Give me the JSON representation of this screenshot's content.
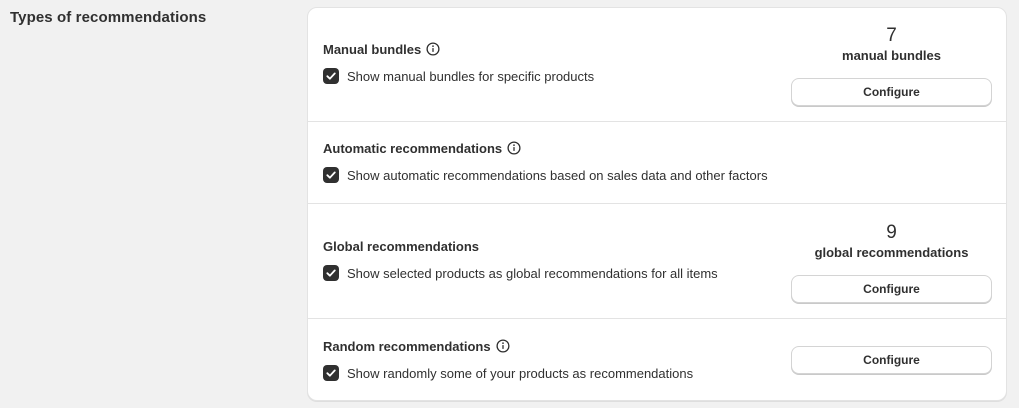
{
  "section": {
    "title": "Types of recommendations"
  },
  "rows": [
    {
      "title": "Manual bundles",
      "has_info": true,
      "checkbox_checked": true,
      "checkbox_label": "Show manual bundles for specific products",
      "stat_number": "7",
      "stat_label": "manual bundles",
      "button_label": "Configure"
    },
    {
      "title": "Automatic recommendations",
      "has_info": true,
      "checkbox_checked": true,
      "checkbox_label": "Show automatic recommendations based on sales data and other factors"
    },
    {
      "title": "Global recommendations",
      "has_info": false,
      "checkbox_checked": true,
      "checkbox_label": "Show selected products as global recommendations for all items",
      "stat_number": "9",
      "stat_label": "global recommendations",
      "button_label": "Configure"
    },
    {
      "title": "Random recommendations",
      "has_info": true,
      "checkbox_checked": true,
      "checkbox_label": "Show randomly some of your products as recommendations",
      "button_label": "Configure"
    }
  ],
  "colors": {
    "background": "#f1f1f1",
    "card": "#ffffff",
    "text": "#303030",
    "checkbox_fill": "#303030",
    "divider": "#e3e3e3"
  }
}
